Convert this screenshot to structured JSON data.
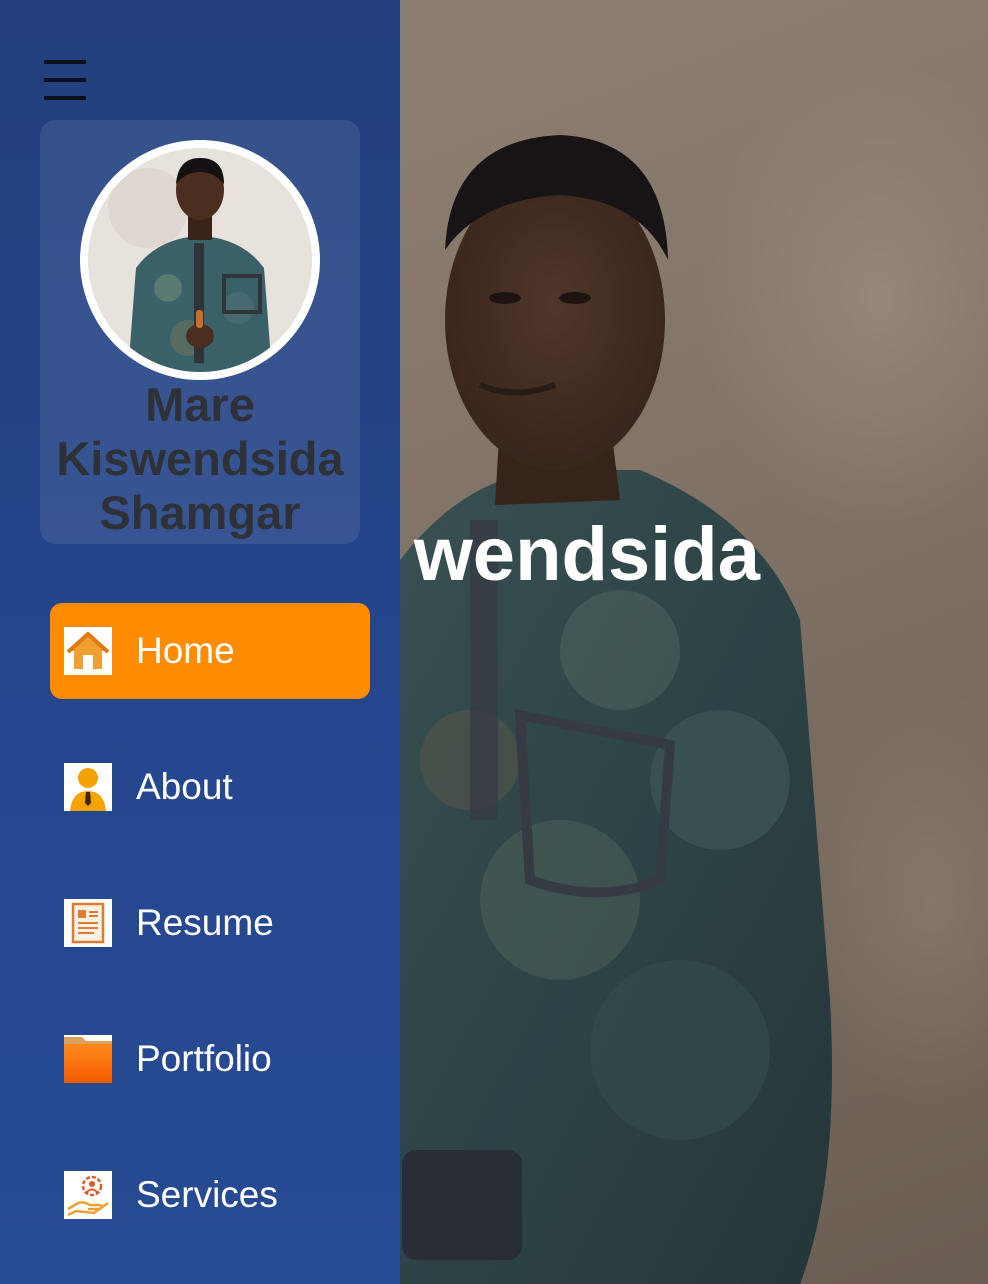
{
  "sidebar": {
    "menu_icon": "hamburger-menu-icon",
    "profile": {
      "name_lines": [
        "Mare",
        "Kiswendsida",
        "Shamgar"
      ]
    },
    "nav": [
      {
        "label": "Home",
        "icon": "home-icon",
        "active": true
      },
      {
        "label": "About",
        "icon": "user-icon",
        "active": false
      },
      {
        "label": "Resume",
        "icon": "resume-icon",
        "active": false
      },
      {
        "label": "Portfolio",
        "icon": "folder-icon",
        "active": false
      },
      {
        "label": "Services",
        "icon": "services-icon",
        "active": false
      }
    ]
  },
  "hero": {
    "visible_name": "wendsida"
  },
  "colors": {
    "sidebar_bg": "#25478f",
    "active_accent": "#ff8c00",
    "name_text": "#2e3138"
  }
}
